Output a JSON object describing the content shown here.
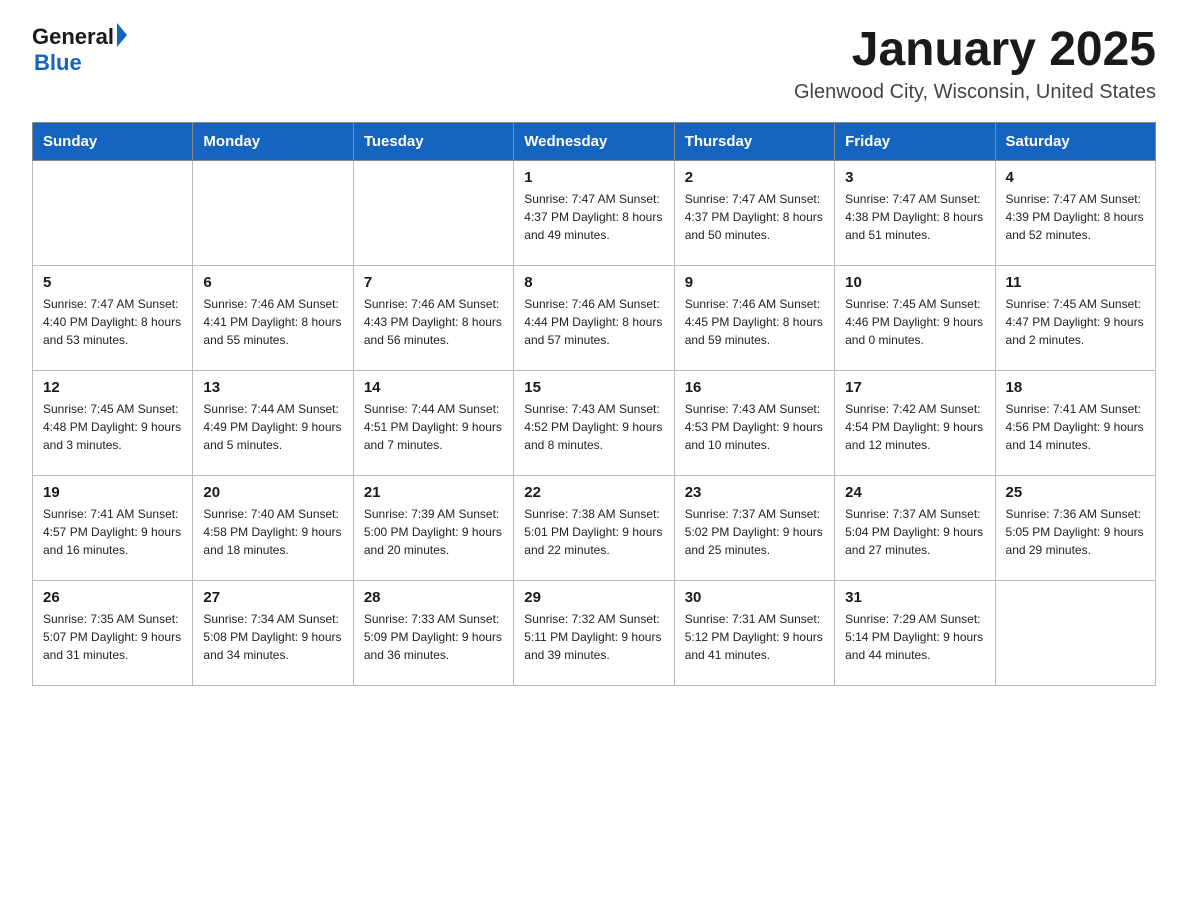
{
  "header": {
    "logo": {
      "line1": "General",
      "arrow": true,
      "line2": "Blue"
    },
    "title": "January 2025",
    "subtitle": "Glenwood City, Wisconsin, United States"
  },
  "days_of_week": [
    "Sunday",
    "Monday",
    "Tuesday",
    "Wednesday",
    "Thursday",
    "Friday",
    "Saturday"
  ],
  "weeks": [
    [
      {
        "day": "",
        "info": ""
      },
      {
        "day": "",
        "info": ""
      },
      {
        "day": "",
        "info": ""
      },
      {
        "day": "1",
        "info": "Sunrise: 7:47 AM\nSunset: 4:37 PM\nDaylight: 8 hours\nand 49 minutes."
      },
      {
        "day": "2",
        "info": "Sunrise: 7:47 AM\nSunset: 4:37 PM\nDaylight: 8 hours\nand 50 minutes."
      },
      {
        "day": "3",
        "info": "Sunrise: 7:47 AM\nSunset: 4:38 PM\nDaylight: 8 hours\nand 51 minutes."
      },
      {
        "day": "4",
        "info": "Sunrise: 7:47 AM\nSunset: 4:39 PM\nDaylight: 8 hours\nand 52 minutes."
      }
    ],
    [
      {
        "day": "5",
        "info": "Sunrise: 7:47 AM\nSunset: 4:40 PM\nDaylight: 8 hours\nand 53 minutes."
      },
      {
        "day": "6",
        "info": "Sunrise: 7:46 AM\nSunset: 4:41 PM\nDaylight: 8 hours\nand 55 minutes."
      },
      {
        "day": "7",
        "info": "Sunrise: 7:46 AM\nSunset: 4:43 PM\nDaylight: 8 hours\nand 56 minutes."
      },
      {
        "day": "8",
        "info": "Sunrise: 7:46 AM\nSunset: 4:44 PM\nDaylight: 8 hours\nand 57 minutes."
      },
      {
        "day": "9",
        "info": "Sunrise: 7:46 AM\nSunset: 4:45 PM\nDaylight: 8 hours\nand 59 minutes."
      },
      {
        "day": "10",
        "info": "Sunrise: 7:45 AM\nSunset: 4:46 PM\nDaylight: 9 hours\nand 0 minutes."
      },
      {
        "day": "11",
        "info": "Sunrise: 7:45 AM\nSunset: 4:47 PM\nDaylight: 9 hours\nand 2 minutes."
      }
    ],
    [
      {
        "day": "12",
        "info": "Sunrise: 7:45 AM\nSunset: 4:48 PM\nDaylight: 9 hours\nand 3 minutes."
      },
      {
        "day": "13",
        "info": "Sunrise: 7:44 AM\nSunset: 4:49 PM\nDaylight: 9 hours\nand 5 minutes."
      },
      {
        "day": "14",
        "info": "Sunrise: 7:44 AM\nSunset: 4:51 PM\nDaylight: 9 hours\nand 7 minutes."
      },
      {
        "day": "15",
        "info": "Sunrise: 7:43 AM\nSunset: 4:52 PM\nDaylight: 9 hours\nand 8 minutes."
      },
      {
        "day": "16",
        "info": "Sunrise: 7:43 AM\nSunset: 4:53 PM\nDaylight: 9 hours\nand 10 minutes."
      },
      {
        "day": "17",
        "info": "Sunrise: 7:42 AM\nSunset: 4:54 PM\nDaylight: 9 hours\nand 12 minutes."
      },
      {
        "day": "18",
        "info": "Sunrise: 7:41 AM\nSunset: 4:56 PM\nDaylight: 9 hours\nand 14 minutes."
      }
    ],
    [
      {
        "day": "19",
        "info": "Sunrise: 7:41 AM\nSunset: 4:57 PM\nDaylight: 9 hours\nand 16 minutes."
      },
      {
        "day": "20",
        "info": "Sunrise: 7:40 AM\nSunset: 4:58 PM\nDaylight: 9 hours\nand 18 minutes."
      },
      {
        "day": "21",
        "info": "Sunrise: 7:39 AM\nSunset: 5:00 PM\nDaylight: 9 hours\nand 20 minutes."
      },
      {
        "day": "22",
        "info": "Sunrise: 7:38 AM\nSunset: 5:01 PM\nDaylight: 9 hours\nand 22 minutes."
      },
      {
        "day": "23",
        "info": "Sunrise: 7:37 AM\nSunset: 5:02 PM\nDaylight: 9 hours\nand 25 minutes."
      },
      {
        "day": "24",
        "info": "Sunrise: 7:37 AM\nSunset: 5:04 PM\nDaylight: 9 hours\nand 27 minutes."
      },
      {
        "day": "25",
        "info": "Sunrise: 7:36 AM\nSunset: 5:05 PM\nDaylight: 9 hours\nand 29 minutes."
      }
    ],
    [
      {
        "day": "26",
        "info": "Sunrise: 7:35 AM\nSunset: 5:07 PM\nDaylight: 9 hours\nand 31 minutes."
      },
      {
        "day": "27",
        "info": "Sunrise: 7:34 AM\nSunset: 5:08 PM\nDaylight: 9 hours\nand 34 minutes."
      },
      {
        "day": "28",
        "info": "Sunrise: 7:33 AM\nSunset: 5:09 PM\nDaylight: 9 hours\nand 36 minutes."
      },
      {
        "day": "29",
        "info": "Sunrise: 7:32 AM\nSunset: 5:11 PM\nDaylight: 9 hours\nand 39 minutes."
      },
      {
        "day": "30",
        "info": "Sunrise: 7:31 AM\nSunset: 5:12 PM\nDaylight: 9 hours\nand 41 minutes."
      },
      {
        "day": "31",
        "info": "Sunrise: 7:29 AM\nSunset: 5:14 PM\nDaylight: 9 hours\nand 44 minutes."
      },
      {
        "day": "",
        "info": ""
      }
    ]
  ]
}
